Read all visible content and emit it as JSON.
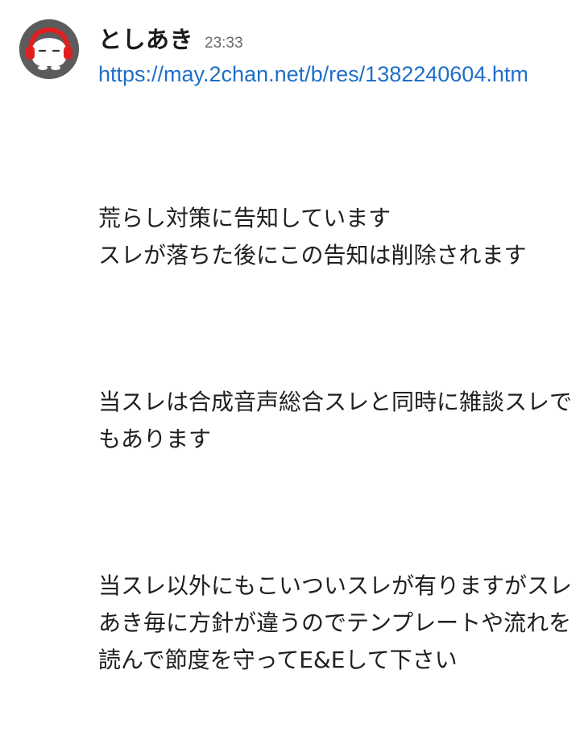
{
  "message": {
    "author": "としあき",
    "timestamp": "23:33",
    "link": "https://may.2chan.net/b/res/1382240604.htm",
    "paragraphs": [
      "荒らし対策に告知しています\nスレが落ちた後にこの告知は削除されます",
      "当スレは合成音声総合スレと同時に雑談スレでもあります",
      "当スレ以外にもこいついスレが有りますがスレあき毎に方針が違うのでテンプレートや流れを読んで節度を守ってE&Eして下さい"
    ]
  },
  "avatar": {
    "icon": "mascot-avatar-icon",
    "background": "#5c5c5c",
    "accent": "#e02020"
  },
  "colors": {
    "link": "#1f6fc8",
    "text": "#1f1f1f",
    "timestamp": "#6b6b6b"
  }
}
